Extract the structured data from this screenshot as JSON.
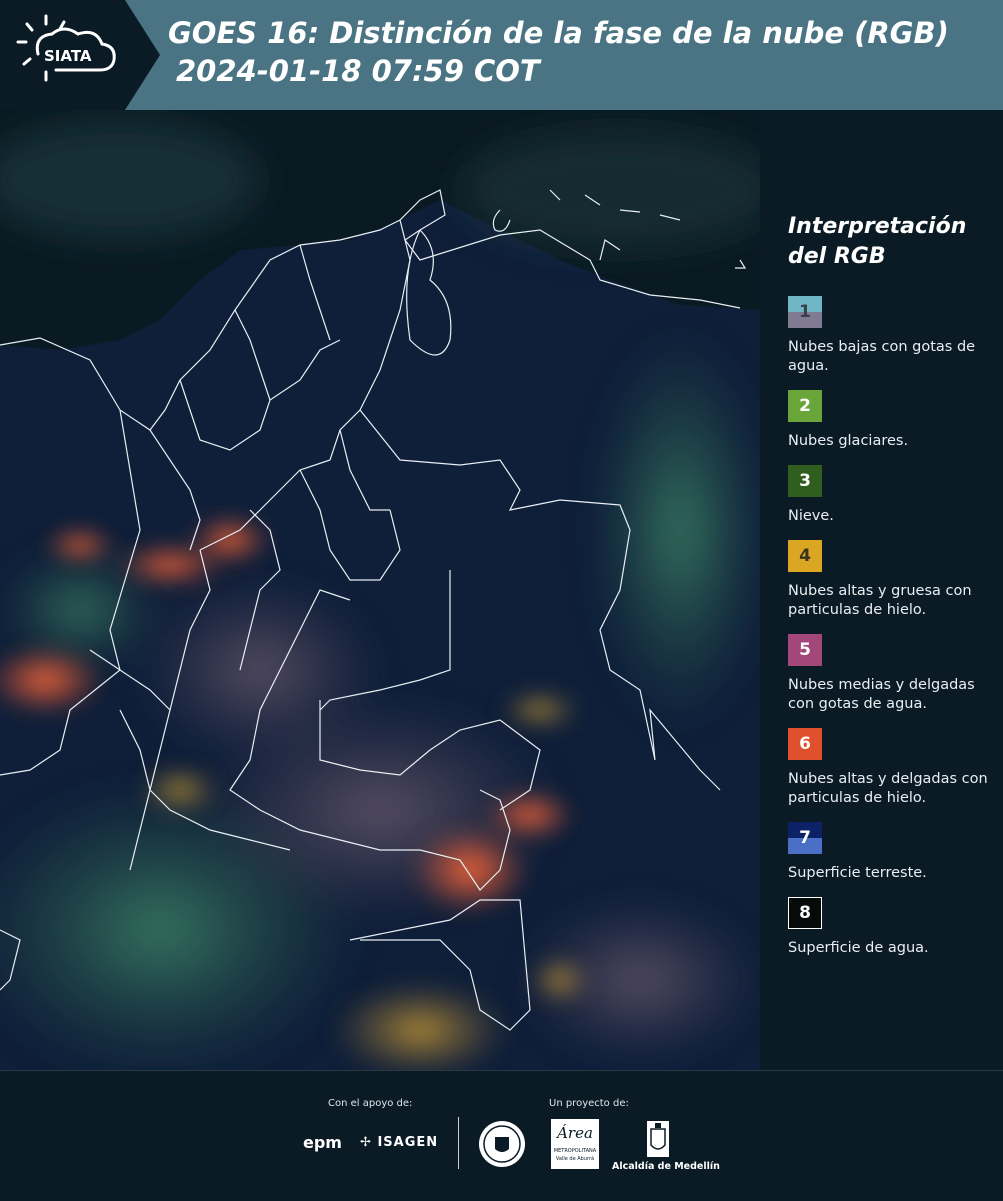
{
  "header": {
    "logo_text": "SIATA",
    "title_line1": "GOES 16: Distinción de la fase de la nube (RGB)",
    "title_line2": "2024-01-18 07:59 COT"
  },
  "legend": {
    "title_line1": "Interpretación",
    "title_line2": "del RGB",
    "items": [
      {
        "number": "1",
        "label": "Nubes bajas con gotas de agua.",
        "color_top": "#6fb7c7",
        "color_bottom": "#807a93"
      },
      {
        "number": "2",
        "label": "Nubes glaciares.",
        "color_top": "#6aa53a",
        "color_bottom": "#6aa53a"
      },
      {
        "number": "3",
        "label": "Nieve.",
        "color_top": "#2f5e1f",
        "color_bottom": "#2f5e1f"
      },
      {
        "number": "4",
        "label": "Nubes altas y gruesa con particulas de hielo.",
        "color_top": "#dba722",
        "color_bottom": "#dba722"
      },
      {
        "number": "5",
        "label": "Nubes medias y delgadas con gotas de agua.",
        "color_top": "#a34679",
        "color_bottom": "#a34679"
      },
      {
        "number": "6",
        "label": "Nubes altas y delgadas con particulas de hielo.",
        "color_top": "#e0502d",
        "color_bottom": "#e0502d"
      },
      {
        "number": "7",
        "label": "Superficie terreste.",
        "color_top": "#0d2166",
        "color_bottom": "#4a6fc7"
      },
      {
        "number": "8",
        "label": "Superficie de agua.",
        "color_top": "#060a08",
        "color_bottom": "#060a08"
      }
    ]
  },
  "footer": {
    "support_label": "Con el apoyo de:",
    "project_label": "Un proyecto de:",
    "sponsor_epm": "epm",
    "sponsor_isagen": "ISAGEN",
    "area_logo_text": "Área",
    "area_sub1": "METROPOLITANA",
    "area_sub2": "Valle de Aburrá",
    "alcaldia": "Alcaldía de Medellín"
  },
  "colors": {
    "header_bg": "#4a7483",
    "page_bg": "#0b1b26",
    "ocean": "#0a1a22",
    "land": "#0f1f3a"
  }
}
